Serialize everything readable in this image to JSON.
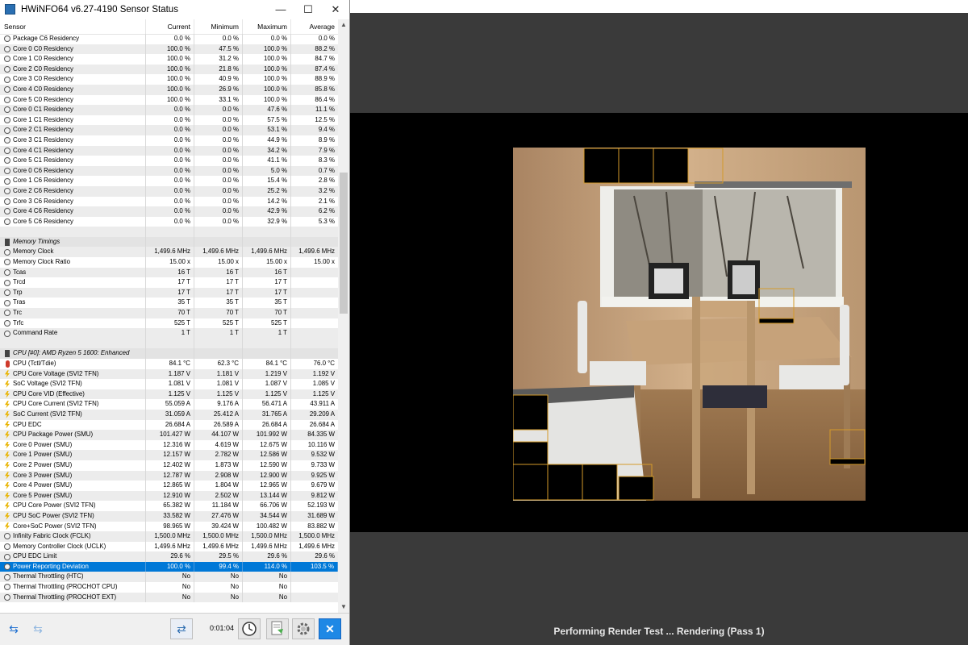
{
  "window": {
    "title": "HWiNFO64 v6.27-4190 Sensor Status",
    "minimize": "—",
    "maximize": "☐",
    "close": "✕"
  },
  "columns": {
    "sensor": "Sensor",
    "current": "Current",
    "minimum": "Minimum",
    "maximum": "Maximum",
    "average": "Average"
  },
  "rows": [
    {
      "icon": "clock",
      "name": "Package C6 Residency",
      "cur": "0.0 %",
      "min": "0.0 %",
      "max": "0.0 %",
      "avg": "0.0 %"
    },
    {
      "icon": "clock",
      "name": "Core 0 C0 Residency",
      "cur": "100.0 %",
      "min": "47.5 %",
      "max": "100.0 %",
      "avg": "88.2 %"
    },
    {
      "icon": "clock",
      "name": "Core 1 C0 Residency",
      "cur": "100.0 %",
      "min": "31.2 %",
      "max": "100.0 %",
      "avg": "84.7 %"
    },
    {
      "icon": "clock",
      "name": "Core 2 C0 Residency",
      "cur": "100.0 %",
      "min": "21.8 %",
      "max": "100.0 %",
      "avg": "87.4 %"
    },
    {
      "icon": "clock",
      "name": "Core 3 C0 Residency",
      "cur": "100.0 %",
      "min": "40.9 %",
      "max": "100.0 %",
      "avg": "88.9 %"
    },
    {
      "icon": "clock",
      "name": "Core 4 C0 Residency",
      "cur": "100.0 %",
      "min": "26.9 %",
      "max": "100.0 %",
      "avg": "85.8 %"
    },
    {
      "icon": "clock",
      "name": "Core 5 C0 Residency",
      "cur": "100.0 %",
      "min": "33.1 %",
      "max": "100.0 %",
      "avg": "86.4 %"
    },
    {
      "icon": "clock",
      "name": "Core 0 C1 Residency",
      "cur": "0.0 %",
      "min": "0.0 %",
      "max": "47.6 %",
      "avg": "11.1 %"
    },
    {
      "icon": "clock",
      "name": "Core 1 C1 Residency",
      "cur": "0.0 %",
      "min": "0.0 %",
      "max": "57.5 %",
      "avg": "12.5 %"
    },
    {
      "icon": "clock",
      "name": "Core 2 C1 Residency",
      "cur": "0.0 %",
      "min": "0.0 %",
      "max": "53.1 %",
      "avg": "9.4 %"
    },
    {
      "icon": "clock",
      "name": "Core 3 C1 Residency",
      "cur": "0.0 %",
      "min": "0.0 %",
      "max": "44.9 %",
      "avg": "8.9 %"
    },
    {
      "icon": "clock",
      "name": "Core 4 C1 Residency",
      "cur": "0.0 %",
      "min": "0.0 %",
      "max": "34.2 %",
      "avg": "7.9 %"
    },
    {
      "icon": "clock",
      "name": "Core 5 C1 Residency",
      "cur": "0.0 %",
      "min": "0.0 %",
      "max": "41.1 %",
      "avg": "8.3 %"
    },
    {
      "icon": "clock",
      "name": "Core 0 C6 Residency",
      "cur": "0.0 %",
      "min": "0.0 %",
      "max": "5.0 %",
      "avg": "0.7 %"
    },
    {
      "icon": "clock",
      "name": "Core 1 C6 Residency",
      "cur": "0.0 %",
      "min": "0.0 %",
      "max": "15.4 %",
      "avg": "2.8 %"
    },
    {
      "icon": "clock",
      "name": "Core 2 C6 Residency",
      "cur": "0.0 %",
      "min": "0.0 %",
      "max": "25.2 %",
      "avg": "3.2 %"
    },
    {
      "icon": "clock",
      "name": "Core 3 C6 Residency",
      "cur": "0.0 %",
      "min": "0.0 %",
      "max": "14.2 %",
      "avg": "2.1 %"
    },
    {
      "icon": "clock",
      "name": "Core 4 C6 Residency",
      "cur": "0.0 %",
      "min": "0.0 %",
      "max": "42.9 %",
      "avg": "6.2 %"
    },
    {
      "icon": "clock",
      "name": "Core 5 C6 Residency",
      "cur": "0.0 %",
      "min": "0.0 %",
      "max": "32.9 %",
      "avg": "5.3 %"
    },
    {
      "type": "blank"
    },
    {
      "type": "group",
      "icon": "mem",
      "name": "Memory Timings"
    },
    {
      "icon": "clock",
      "name": "Memory Clock",
      "cur": "1,499.6 MHz",
      "min": "1,499.6 MHz",
      "max": "1,499.6 MHz",
      "avg": "1,499.6 MHz"
    },
    {
      "icon": "clock",
      "name": "Memory Clock Ratio",
      "cur": "15.00 x",
      "min": "15.00 x",
      "max": "15.00 x",
      "avg": "15.00 x"
    },
    {
      "icon": "clock",
      "name": "Tcas",
      "cur": "16 T",
      "min": "16 T",
      "max": "16 T",
      "avg": ""
    },
    {
      "icon": "clock",
      "name": "Trcd",
      "cur": "17 T",
      "min": "17 T",
      "max": "17 T",
      "avg": ""
    },
    {
      "icon": "clock",
      "name": "Trp",
      "cur": "17 T",
      "min": "17 T",
      "max": "17 T",
      "avg": ""
    },
    {
      "icon": "clock",
      "name": "Tras",
      "cur": "35 T",
      "min": "35 T",
      "max": "35 T",
      "avg": ""
    },
    {
      "icon": "clock",
      "name": "Trc",
      "cur": "70 T",
      "min": "70 T",
      "max": "70 T",
      "avg": ""
    },
    {
      "icon": "clock",
      "name": "Trfc",
      "cur": "525 T",
      "min": "525 T",
      "max": "525 T",
      "avg": ""
    },
    {
      "icon": "clock",
      "name": "Command Rate",
      "cur": "1 T",
      "min": "1 T",
      "max": "1 T",
      "avg": ""
    },
    {
      "type": "blank"
    },
    {
      "type": "group",
      "icon": "cpu",
      "name": "CPU [#0]: AMD Ryzen 5 1600: Enhanced"
    },
    {
      "icon": "therm",
      "name": "CPU (Tctl/Tdie)",
      "cur": "84.1 °C",
      "min": "62.3 °C",
      "max": "84.1 °C",
      "avg": "76.0 °C"
    },
    {
      "icon": "volt",
      "name": "CPU Core Voltage (SVI2 TFN)",
      "cur": "1.187 V",
      "min": "1.181 V",
      "max": "1.219 V",
      "avg": "1.192 V"
    },
    {
      "icon": "volt",
      "name": "SoC Voltage (SVI2 TFN)",
      "cur": "1.081 V",
      "min": "1.081 V",
      "max": "1.087 V",
      "avg": "1.085 V"
    },
    {
      "icon": "volt",
      "name": "CPU Core VID (Effective)",
      "cur": "1.125 V",
      "min": "1.125 V",
      "max": "1.125 V",
      "avg": "1.125 V"
    },
    {
      "icon": "volt",
      "name": "CPU Core Current (SVI2 TFN)",
      "cur": "55.059 A",
      "min": "9.176 A",
      "max": "56.471 A",
      "avg": "43.911 A"
    },
    {
      "icon": "volt",
      "name": "SoC Current (SVI2 TFN)",
      "cur": "31.059 A",
      "min": "25.412 A",
      "max": "31.765 A",
      "avg": "29.209 A"
    },
    {
      "icon": "volt",
      "name": "CPU EDC",
      "cur": "26.684 A",
      "min": "26.589 A",
      "max": "26.684 A",
      "avg": "26.684 A"
    },
    {
      "icon": "volt",
      "name": "CPU Package Power (SMU)",
      "cur": "101.427 W",
      "min": "44.107 W",
      "max": "101.992 W",
      "avg": "84.335 W"
    },
    {
      "icon": "volt",
      "name": "Core 0 Power (SMU)",
      "cur": "12.316 W",
      "min": "4.619 W",
      "max": "12.675 W",
      "avg": "10.116 W"
    },
    {
      "icon": "volt",
      "name": "Core 1 Power (SMU)",
      "cur": "12.157 W",
      "min": "2.782 W",
      "max": "12.586 W",
      "avg": "9.532 W"
    },
    {
      "icon": "volt",
      "name": "Core 2 Power (SMU)",
      "cur": "12.402 W",
      "min": "1.873 W",
      "max": "12.590 W",
      "avg": "9.733 W"
    },
    {
      "icon": "volt",
      "name": "Core 3 Power (SMU)",
      "cur": "12.787 W",
      "min": "2.908 W",
      "max": "12.900 W",
      "avg": "9.925 W"
    },
    {
      "icon": "volt",
      "name": "Core 4 Power (SMU)",
      "cur": "12.865 W",
      "min": "1.804 W",
      "max": "12.965 W",
      "avg": "9.679 W"
    },
    {
      "icon": "volt",
      "name": "Core 5 Power (SMU)",
      "cur": "12.910 W",
      "min": "2.502 W",
      "max": "13.144 W",
      "avg": "9.812 W"
    },
    {
      "icon": "volt",
      "name": "CPU Core Power (SVI2 TFN)",
      "cur": "65.382 W",
      "min": "11.184 W",
      "max": "66.706 W",
      "avg": "52.193 W"
    },
    {
      "icon": "volt",
      "name": "CPU SoC Power (SVI2 TFN)",
      "cur": "33.582 W",
      "min": "27.476 W",
      "max": "34.544 W",
      "avg": "31.689 W"
    },
    {
      "icon": "volt",
      "name": "Core+SoC Power (SVI2 TFN)",
      "cur": "98.965 W",
      "min": "39.424 W",
      "max": "100.482 W",
      "avg": "83.882 W"
    },
    {
      "icon": "clock",
      "name": "Infinity Fabric Clock (FCLK)",
      "cur": "1,500.0 MHz",
      "min": "1,500.0 MHz",
      "max": "1,500.0 MHz",
      "avg": "1,500.0 MHz"
    },
    {
      "icon": "clock",
      "name": "Memory Controller Clock (UCLK)",
      "cur": "1,499.6 MHz",
      "min": "1,499.6 MHz",
      "max": "1,499.6 MHz",
      "avg": "1,499.6 MHz"
    },
    {
      "icon": "clock",
      "name": "CPU EDC Limit",
      "cur": "29.6 %",
      "min": "29.5 %",
      "max": "29.6 %",
      "avg": "29.6 %"
    },
    {
      "icon": "clock",
      "name": "Power Reporting Deviation",
      "cur": "100.0 %",
      "min": "99.4 %",
      "max": "114.0 %",
      "avg": "103.5 %",
      "selected": true
    },
    {
      "icon": "clock",
      "name": "Thermal Throttling (HTC)",
      "cur": "No",
      "min": "No",
      "max": "No",
      "avg": ""
    },
    {
      "icon": "clock",
      "name": "Thermal Throttling (PROCHOT CPU)",
      "cur": "No",
      "min": "No",
      "max": "No",
      "avg": ""
    },
    {
      "icon": "clock",
      "name": "Thermal Throttling (PROCHOT EXT)",
      "cur": "No",
      "min": "No",
      "max": "No",
      "avg": ""
    }
  ],
  "statusbar": {
    "elapsed": "0:01:04",
    "nav_icon": "arrows-icon",
    "network_icon": "network-icon",
    "clock_icon": "clock-icon",
    "report_icon": "report-icon",
    "settings_icon": "gear-icon",
    "close_icon": "close-icon"
  },
  "render": {
    "status": "Performing Render Test ... Rendering (Pass 1)"
  },
  "colors": {
    "selection": "#0078d7",
    "close_accent": "#1e88e5"
  }
}
